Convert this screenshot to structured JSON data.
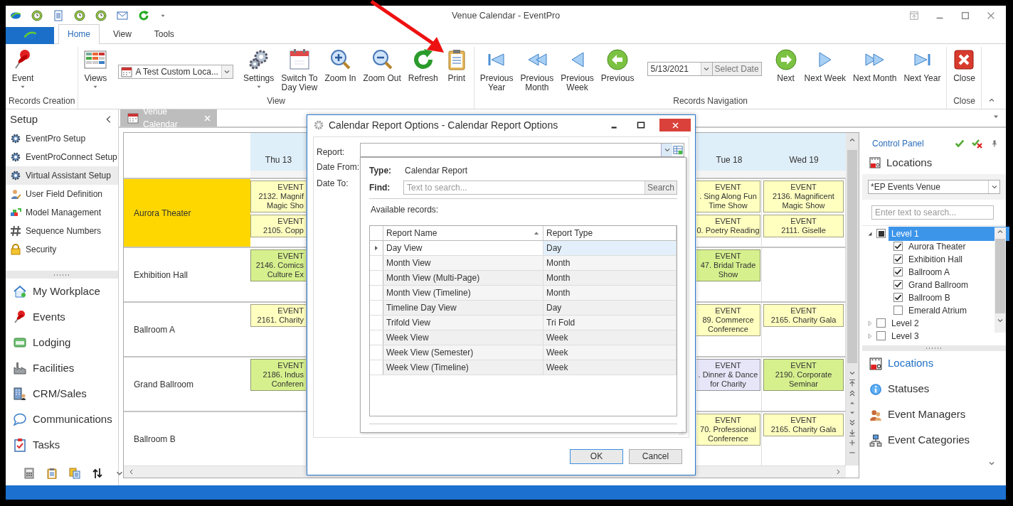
{
  "window": {
    "title": "Venue Calendar - EventPro"
  },
  "ribbon": {
    "tabs": [
      {
        "label": "Home",
        "selected": true
      },
      {
        "label": "View",
        "selected": false
      },
      {
        "label": "Tools",
        "selected": false
      }
    ],
    "groups": [
      {
        "title": "Records Creation",
        "items": [
          {
            "kind": "large",
            "label": "Event",
            "menu": true
          }
        ]
      },
      {
        "title": "View",
        "items": [
          {
            "kind": "large",
            "label": "Views",
            "menu": true
          },
          {
            "kind": "combo",
            "value": "A Test Custom Loca..."
          },
          {
            "kind": "large",
            "label": "Settings",
            "menu": true
          },
          {
            "kind": "large",
            "label": "Switch To\nDay View",
            "menu": false
          },
          {
            "kind": "large",
            "label": "Zoom In",
            "menu": false
          },
          {
            "kind": "large",
            "label": "Zoom Out",
            "menu": false
          },
          {
            "kind": "large",
            "label": "Refresh",
            "menu": false
          },
          {
            "kind": "large",
            "label": "Print",
            "menu": false
          }
        ]
      },
      {
        "title": "Records Navigation",
        "items": [
          {
            "kind": "large",
            "label": "Previous\nYear",
            "menu": false
          },
          {
            "kind": "large",
            "label": "Previous\nMonth",
            "menu": false
          },
          {
            "kind": "large",
            "label": "Previous\nWeek",
            "menu": false
          },
          {
            "kind": "large",
            "label": "Previous",
            "menu": false
          },
          {
            "kind": "date",
            "value": "5/13/2021",
            "button": "Select Date",
            "disabled": true
          },
          {
            "kind": "large",
            "label": "Next",
            "menu": false
          },
          {
            "kind": "large",
            "label": "Next Week",
            "menu": false
          },
          {
            "kind": "large",
            "label": "Next Month",
            "menu": false
          },
          {
            "kind": "large",
            "label": "Next Year",
            "menu": false
          }
        ]
      },
      {
        "title": "Close",
        "items": [
          {
            "kind": "large",
            "label": "Close",
            "menu": false
          }
        ]
      }
    ]
  },
  "sidebar": {
    "title": "Setup",
    "items": [
      {
        "label": "EventPro Setup",
        "selected": false
      },
      {
        "label": "EventProConnect Setup",
        "selected": false
      },
      {
        "label": "Virtual Assistant Setup",
        "selected": true
      },
      {
        "label": "User Field Definition",
        "selected": false
      },
      {
        "label": "Model Management",
        "selected": false
      },
      {
        "label": "Sequence Numbers",
        "selected": false
      },
      {
        "label": "Security",
        "selected": false
      }
    ],
    "nav": [
      {
        "label": "My Workplace"
      },
      {
        "label": "Events"
      },
      {
        "label": "Lodging"
      },
      {
        "label": "Facilities"
      },
      {
        "label": "CRM/Sales"
      },
      {
        "label": "Communications"
      },
      {
        "label": "Tasks"
      }
    ]
  },
  "calendar": {
    "tab": {
      "label": "Venue Calendar"
    },
    "days": [
      {
        "label": "Thu 13"
      },
      {
        "label": "Tue 18"
      },
      {
        "label": "Wed 19"
      }
    ],
    "rooms": [
      {
        "name": "Aurora Theater",
        "selected": true,
        "day_1": [
          {
            "label": "EVENT",
            "title": "2132. Magnif\nMagic Sho",
            "color": "#ffffc0"
          },
          {
            "label": "EVENT",
            "title": "2105. Copp",
            "color": "#ffffc0"
          }
        ],
        "day_2": [
          {
            "label": "EVENT",
            "title": ". Sing Along Fun\nTime Show",
            "color": "#ffffc0"
          },
          {
            "label": "EVENT",
            "title": "0. Poetry Reading",
            "color": "#ffffc0"
          }
        ],
        "day_3": [
          {
            "label": "EVENT",
            "title": "2136. Magnificent\nMagic Show",
            "color": "#ffffc0"
          },
          {
            "label": "EVENT",
            "title": "2111. Giselle",
            "color": "#ffffc0"
          }
        ]
      },
      {
        "name": "Exhibition Hall",
        "selected": false,
        "day_1": [
          {
            "label": "EVENT",
            "title": "2146. Comics\nCulture Ex",
            "color": "#d6f08e"
          }
        ],
        "day_2": [
          {
            "label": "EVENT",
            "title": "47. Bridal Trade\nShow",
            "color": "#d6f08e"
          }
        ]
      },
      {
        "name": "Ballroom A",
        "selected": false,
        "day_1": [
          {
            "label": "EVENT",
            "title": "2161. Charity",
            "color": "#ffffc0"
          }
        ],
        "day_2": [
          {
            "label": "EVENT",
            "title": "89. Commerce\nConference",
            "color": "#ffffc0"
          }
        ],
        "day_3": [
          {
            "label": "EVENT",
            "title": "2165. Charity Gala",
            "color": "#ffffc0"
          }
        ]
      },
      {
        "name": "Grand Ballroom",
        "selected": false,
        "day_1": [
          {
            "label": "EVENT",
            "title": "2186. Indus\nConferen",
            "color": "#d6f08e"
          }
        ],
        "day_2": [
          {
            "label": "EVENT",
            "title": ". Dinner & Dance\nfor Charity",
            "color": "#e6e6f8"
          }
        ],
        "day_3": [
          {
            "label": "EVENT",
            "title": "2190. Corporate\nSeminar",
            "color": "#d6f08e"
          }
        ]
      },
      {
        "name": "Ballroom B",
        "selected": false,
        "day_2": [
          {
            "label": "EVENT",
            "title": "70. Professional\nConference",
            "color": "#ffffc0"
          }
        ],
        "day_3": [
          {
            "label": "EVENT",
            "title": "2165. Charity Gala",
            "color": "#ffffc0"
          }
        ]
      }
    ]
  },
  "control_panel": {
    "title": "Control Panel",
    "section": "Locations",
    "venue": "*EP Events Venue",
    "search_placeholder": "Enter text to search...",
    "tree": [
      {
        "label": "Level 1",
        "selected": true,
        "expanded": true,
        "checked": false,
        "indeterminate": true,
        "children": [
          {
            "label": "Aurora Theater",
            "selected": false,
            "checked": true
          },
          {
            "label": "Exhibition Hall",
            "selected": false,
            "checked": true
          },
          {
            "label": "Ballroom A",
            "selected": false,
            "checked": true
          },
          {
            "label": "Grand Ballroom",
            "selected": false,
            "checked": true
          },
          {
            "label": "Ballroom B",
            "selected": false,
            "checked": true
          },
          {
            "label": "Emerald Atrium",
            "selected": false,
            "checked": false
          }
        ]
      },
      {
        "label": "Level 2",
        "selected": false,
        "expanded": false,
        "checked": false
      },
      {
        "label": "Level 3",
        "selected": false,
        "expanded": false,
        "checked": false
      }
    ],
    "nav": [
      {
        "label": "Locations",
        "selected": true
      },
      {
        "label": "Statuses",
        "selected": false
      },
      {
        "label": "Event Managers",
        "selected": false
      },
      {
        "label": "Event Categories",
        "selected": false
      }
    ]
  },
  "dialog": {
    "title": "Calendar Report Options - Calendar Report Options",
    "fields": [
      {
        "label": "Report:"
      },
      {
        "label": "Date From:"
      },
      {
        "label": "Date To:"
      }
    ],
    "popup": {
      "type_label": "Type:",
      "type_value": "Calendar Report",
      "find_label": "Find:",
      "find_placeholder": "Text to search...",
      "search_button": "Search",
      "records_label": "Available records:",
      "columns": [
        {
          "label": "Report Name",
          "sorted": true
        },
        {
          "label": "Report Type",
          "sorted": false
        }
      ],
      "rows": [
        {
          "name": "Day View",
          "type": "Day",
          "selected": true
        },
        {
          "name": "Month View",
          "type": "Month",
          "selected": false
        },
        {
          "name": "Month View (Multi-Page)",
          "type": "Month",
          "selected": false
        },
        {
          "name": "Month View (Timeline)",
          "type": "Month",
          "selected": false
        },
        {
          "name": "Timeline Day View",
          "type": "Day",
          "selected": false
        },
        {
          "name": "Trifold View",
          "type": "Tri Fold",
          "selected": false
        },
        {
          "name": "Week View",
          "type": "Week",
          "selected": false
        },
        {
          "name": "Week View (Semester)",
          "type": "Week",
          "selected": false
        },
        {
          "name": "Week View (Timeline)",
          "type": "Week",
          "selected": false
        }
      ]
    },
    "buttons": [
      {
        "label": "OK",
        "default": true
      },
      {
        "label": "Cancel",
        "default": false
      }
    ]
  }
}
